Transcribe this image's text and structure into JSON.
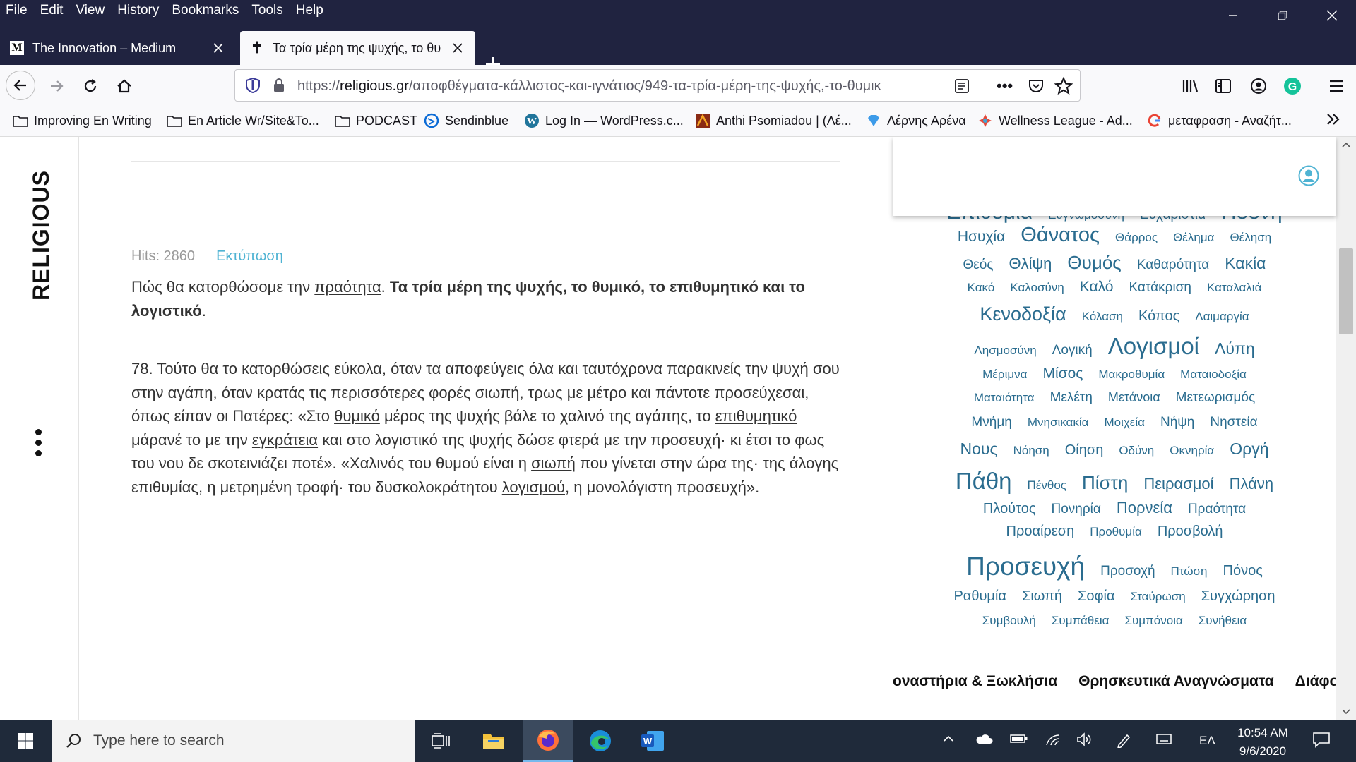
{
  "menu": {
    "items": [
      "File",
      "Edit",
      "View",
      "History",
      "Bookmarks",
      "Tools",
      "Help"
    ]
  },
  "tabs": [
    {
      "title": "The Innovation – Medium",
      "favicon": "M",
      "active": false
    },
    {
      "title": "Τα τρία μέρη της ψυχής, το θυ",
      "favicon": "✝",
      "active": true
    }
  ],
  "nav": {
    "url_prefix": "https://",
    "url_domain": "religious.gr",
    "url_path": "/αποφθέγματα-κάλλιστος-και-ιγνάτιος/949-τα-τρία-μέρη-της-ψυχής,-το-θυμικ"
  },
  "bookmarks": [
    {
      "label": "Improving En Writing",
      "icon": "folder-icon"
    },
    {
      "label": "En Article Wr/Site&To...",
      "icon": "folder-icon"
    },
    {
      "label": "PODCAST",
      "icon": "folder-icon"
    },
    {
      "label": "Sendinblue",
      "icon": "sendinblue-icon"
    },
    {
      "label": "Log In — WordPress.c...",
      "icon": "wordpress-icon"
    },
    {
      "label": "Anthi Psomiadou | (Λέ...",
      "icon": "site-icon"
    },
    {
      "label": "Λέρνης Αρένα",
      "icon": "diamond-icon"
    },
    {
      "label": "Wellness League - Ad...",
      "icon": "wellness-icon"
    },
    {
      "label": "μεταφραση - Αναζήτ...",
      "icon": "google-icon"
    }
  ],
  "site": {
    "brand": "RELIGIOUS"
  },
  "article": {
    "hits": "Hits: 2860",
    "print": "Εκτύπωση",
    "intro_a": "Πώς θα κατορθώσομε την ",
    "intro_link": "πραότητα",
    "intro_b": ". ",
    "intro_bold": "Τα τρία μέρη της ψυχής, το θυμικό, το επιθυμητικό και το λογιστικό",
    "intro_c": ".",
    "p1": "78. Τούτο θα το κατορθώσεις εύκολα, όταν τα αποφεύγεις όλα και ταυτόχρονα παρακινείς την ψυχή σου στην αγάπη, όταν κρατάς τις περισσότερες φορές σιωπή, τρως με μέτρο και πάντοτε προσεύχεσαι, όπως είπαν οι Πατέρες: «Στο ",
    "l1": "θυμικό",
    "p2": " μέρος της ψυχής βάλε το χαλινό της αγάπης, το ",
    "l2": "επιθυμητικό",
    "p3": " μάρανέ το με την ",
    "l3": "εγκράτεια",
    "p4": " και στο λογιστικό της ψυχής δώσε φτερά με την προσευχή· κι έτσι το φως του νου δε σκοτεινιάζει ποτέ». «Χαλινός του θυμού είναι η ",
    "l4": "σιωπή",
    "p5": " που γίνεται στην ώρα της· της άλογης επιθυμίας, η μετρημένη τροφή· του δυσκολοκράτητου ",
    "l5": "λογισμού",
    "p6": ", η μονολόγιστη προσευχή»."
  },
  "tag_cloud": [
    [
      {
        "t": "Επιθυμία",
        "s": 30
      },
      {
        "t": "Ευγνωμοσύνη",
        "s": 17
      },
      {
        "t": "Ευχαριστία",
        "s": 19
      },
      {
        "t": "Ηδονή",
        "s": 30
      }
    ],
    [
      {
        "t": "Ησυχία",
        "s": 21
      },
      {
        "t": "Θάνατος",
        "s": 29
      },
      {
        "t": "Θάρρος",
        "s": 17
      },
      {
        "t": "Θέλημα",
        "s": 17
      },
      {
        "t": "Θέληση",
        "s": 17
      }
    ],
    [
      {
        "t": "Θεός",
        "s": 19
      },
      {
        "t": "Θλίψη",
        "s": 22
      },
      {
        "t": "Θυμός",
        "s": 26
      },
      {
        "t": "Καθαρότητα",
        "s": 19
      },
      {
        "t": "Κακία",
        "s": 23
      }
    ],
    [
      {
        "t": "Κακό",
        "s": 17
      },
      {
        "t": "Καλοσύνη",
        "s": 17
      },
      {
        "t": "Καλό",
        "s": 21
      },
      {
        "t": "Κατάκριση",
        "s": 19
      },
      {
        "t": "Καταλαλιά",
        "s": 17
      }
    ],
    [
      {
        "t": "Κενοδοξία",
        "s": 27
      },
      {
        "t": "Κόλαση",
        "s": 17
      },
      {
        "t": "Κόπος",
        "s": 20
      },
      {
        "t": "Λαιμαργία",
        "s": 17
      }
    ],
    [
      {
        "t": "Λησμοσύνη",
        "s": 17
      },
      {
        "t": "Λογική",
        "s": 19
      },
      {
        "t": "Λογισμοί",
        "s": 33
      },
      {
        "t": "Λύπη",
        "s": 23
      }
    ],
    [
      {
        "t": "Μέριμνα",
        "s": 17
      },
      {
        "t": "Μίσος",
        "s": 21
      },
      {
        "t": "Μακροθυμία",
        "s": 17
      },
      {
        "t": "Ματαιοδοξία",
        "s": 17
      }
    ],
    [
      {
        "t": "Ματαιότητα",
        "s": 17
      },
      {
        "t": "Μελέτη",
        "s": 19
      },
      {
        "t": "Μετάνοια",
        "s": 18
      },
      {
        "t": "Μετεωρισμός",
        "s": 19
      }
    ],
    [
      {
        "t": "Μνήμη",
        "s": 19
      },
      {
        "t": "Μνησικακία",
        "s": 17
      },
      {
        "t": "Μοιχεία",
        "s": 17
      },
      {
        "t": "Νήψη",
        "s": 19
      },
      {
        "t": "Νηστεία",
        "s": 19
      }
    ],
    [
      {
        "t": "Νους",
        "s": 23
      },
      {
        "t": "Νόηση",
        "s": 17
      },
      {
        "t": "Οίηση",
        "s": 20
      },
      {
        "t": "Οδύνη",
        "s": 17
      },
      {
        "t": "Οκνηρία",
        "s": 17
      },
      {
        "t": "Οργή",
        "s": 23
      }
    ],
    [
      {
        "t": "Πάθη",
        "s": 33
      },
      {
        "t": "Πένθος",
        "s": 17
      },
      {
        "t": "Πίστη",
        "s": 26
      },
      {
        "t": "Πειρασμοί",
        "s": 22
      },
      {
        "t": "Πλάνη",
        "s": 22
      }
    ],
    [
      {
        "t": "Πλούτος",
        "s": 20
      },
      {
        "t": "Πονηρία",
        "s": 19
      },
      {
        "t": "Πορνεία",
        "s": 22
      },
      {
        "t": "Πραότητα",
        "s": 19
      }
    ],
    [
      {
        "t": "Προαίρεση",
        "s": 20
      },
      {
        "t": "Προθυμία",
        "s": 17
      },
      {
        "t": "Προσβολή",
        "s": 20
      }
    ],
    [
      {
        "t": "Προσευχή",
        "s": 37
      },
      {
        "t": "Προσοχή",
        "s": 19
      },
      {
        "t": "Πτώση",
        "s": 17
      },
      {
        "t": "Πόνος",
        "s": 20
      }
    ],
    [
      {
        "t": "Ραθυμία",
        "s": 20
      },
      {
        "t": "Σιωπή",
        "s": 20
      },
      {
        "t": "Σοφία",
        "s": 20
      },
      {
        "t": "Σταύρωση",
        "s": 17
      },
      {
        "t": "Συγχώρηση",
        "s": 20
      }
    ],
    [
      {
        "t": "Συμβουλή",
        "s": 17
      },
      {
        "t": "Συμπάθεια",
        "s": 17
      },
      {
        "t": "Συμπόνοια",
        "s": 17
      },
      {
        "t": "Συνήθεια",
        "s": 17
      }
    ]
  ],
  "bottom_menu": [
    "οναστήρια & Ξωκλήσια",
    "Θρησκευτικά Αναγνώσματα",
    "Διάφορα"
  ],
  "taskbar": {
    "search_placeholder": "Type here to search",
    "time": "10:54 AM",
    "date": "9/6/2020",
    "lang": "ΕΛ"
  },
  "colors": {
    "chrome": "#202340",
    "tag": "#2a6c8f",
    "print_link": "#4fb3d3",
    "taskbar": "#1f2a3a"
  }
}
